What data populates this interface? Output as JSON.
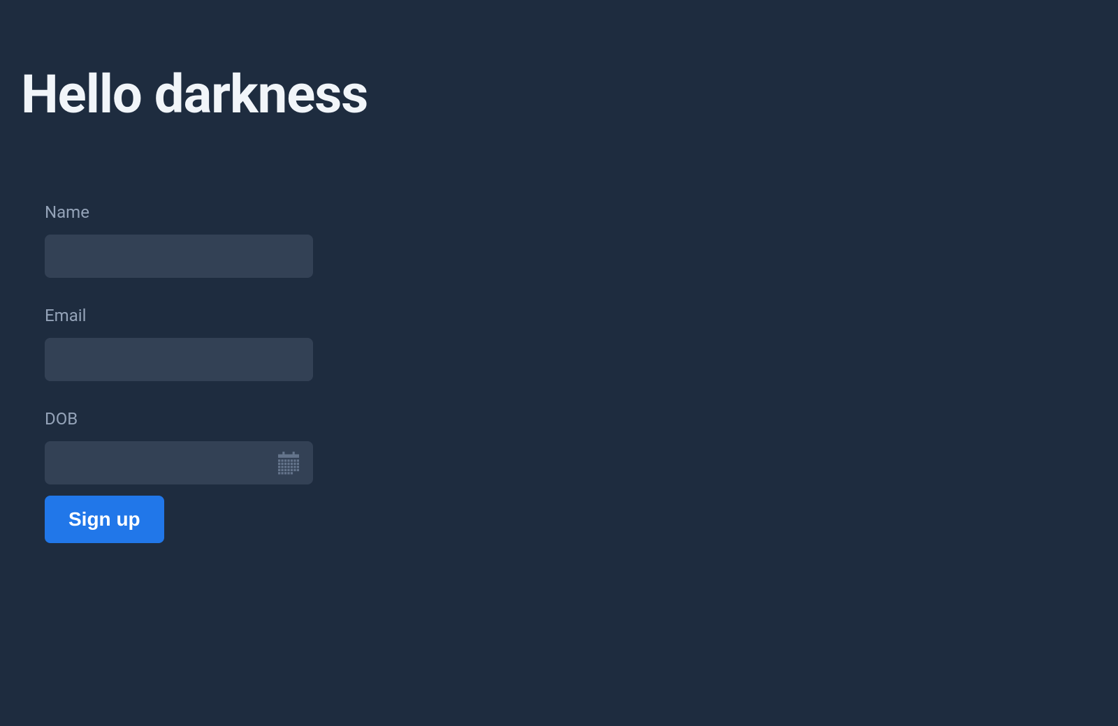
{
  "page": {
    "title": "Hello darkness"
  },
  "form": {
    "name": {
      "label": "Name",
      "value": ""
    },
    "email": {
      "label": "Email",
      "value": ""
    },
    "dob": {
      "label": "DOB",
      "value": ""
    },
    "submit": {
      "label": "Sign up"
    }
  }
}
